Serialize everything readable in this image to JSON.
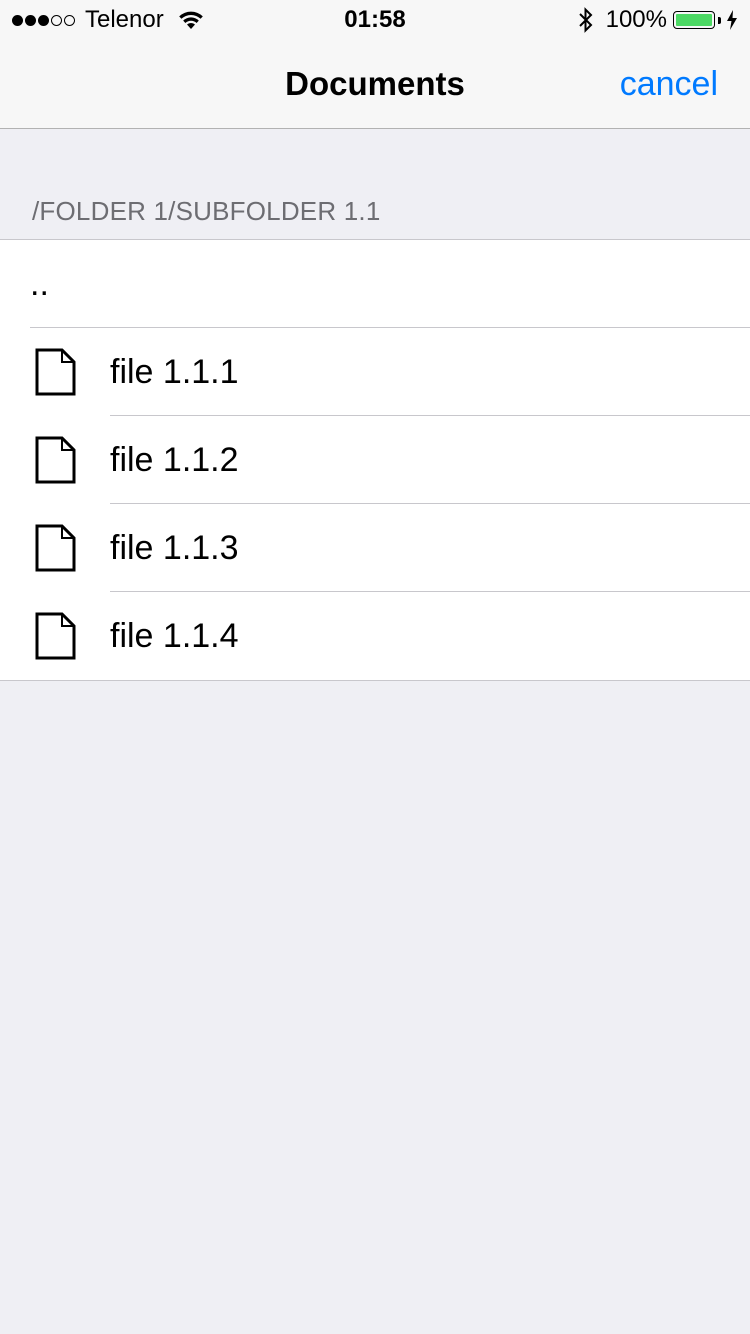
{
  "status_bar": {
    "signal_dots_filled": 3,
    "signal_dots_total": 5,
    "carrier": "Telenor",
    "wifi_icon": "wifi-icon",
    "time": "01:58",
    "bluetooth_icon": "bluetooth-icon",
    "battery_percent": "100%",
    "battery_level": 1.0,
    "battery_color": "#4cd964",
    "charging_icon": "charging-bolt-icon"
  },
  "nav": {
    "title": "Documents",
    "cancel_label": "cancel",
    "accent_color": "#007aff"
  },
  "section": {
    "path": "/FOLDER 1/SUBFOLDER 1.1"
  },
  "list": {
    "parent_label": "..",
    "files": [
      {
        "name": "file 1.1.1",
        "icon": "file-icon"
      },
      {
        "name": "file 1.1.2",
        "icon": "file-icon"
      },
      {
        "name": "file 1.1.3",
        "icon": "file-icon"
      },
      {
        "name": "file 1.1.4",
        "icon": "file-icon"
      }
    ]
  }
}
